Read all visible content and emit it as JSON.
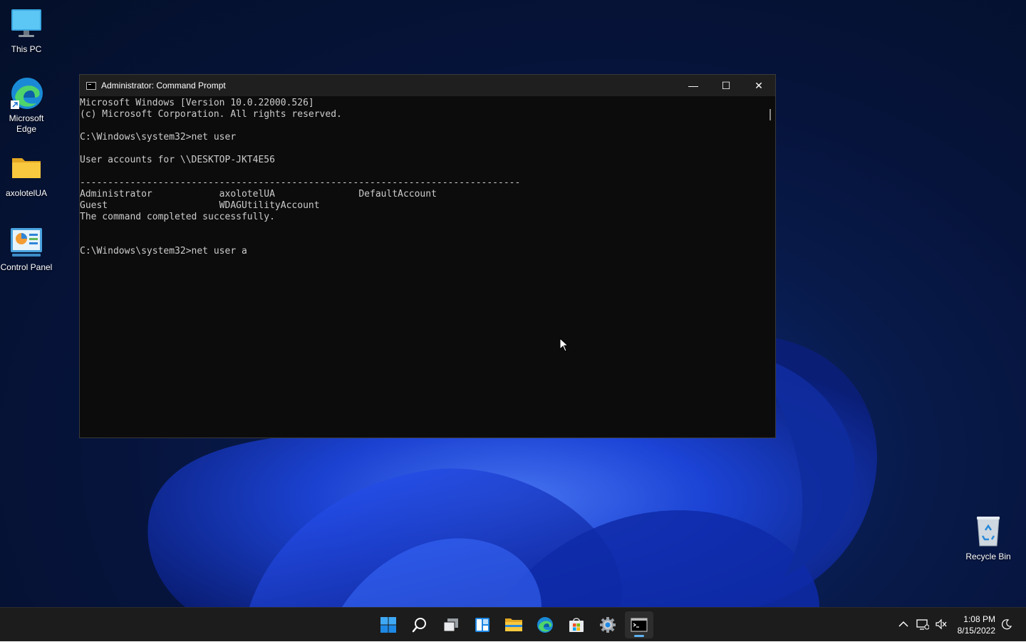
{
  "desktop": {
    "icons": [
      {
        "label": "This PC"
      },
      {
        "label": "Microsoft Edge"
      },
      {
        "label": "axolotelUA"
      },
      {
        "label": "Control Panel"
      },
      {
        "label": "Recycle Bin"
      }
    ]
  },
  "cmd_window": {
    "title": "Administrator: Command Prompt",
    "controls": {
      "minimize": "—",
      "maximize": "☐",
      "close": "✕"
    },
    "console_lines": [
      "Microsoft Windows [Version 10.0.22000.526]",
      "(c) Microsoft Corporation. All rights reserved.",
      "",
      "C:\\Windows\\system32>net user",
      "",
      "User accounts for \\\\DESKTOP-JKT4E56",
      "",
      "-------------------------------------------------------------------------------",
      "Administrator            axolotelUA               DefaultAccount",
      "Guest                    WDAGUtilityAccount",
      "The command completed successfully.",
      "",
      "",
      "C:\\Windows\\system32>net user a"
    ]
  },
  "taskbar": {
    "apps": [
      {
        "name": "start"
      },
      {
        "name": "search"
      },
      {
        "name": "task-view"
      },
      {
        "name": "widgets"
      },
      {
        "name": "file-explorer"
      },
      {
        "name": "edge"
      },
      {
        "name": "store"
      },
      {
        "name": "settings"
      },
      {
        "name": "command-prompt",
        "active": true
      }
    ],
    "clock": {
      "time": "1:08 PM",
      "date": "8/15/2022"
    }
  },
  "colors": {
    "console_bg": "#0c0c0c",
    "console_fg": "#cccccc",
    "taskbar_bg": "#1c1c1c",
    "accent": "#5fb2f2"
  }
}
